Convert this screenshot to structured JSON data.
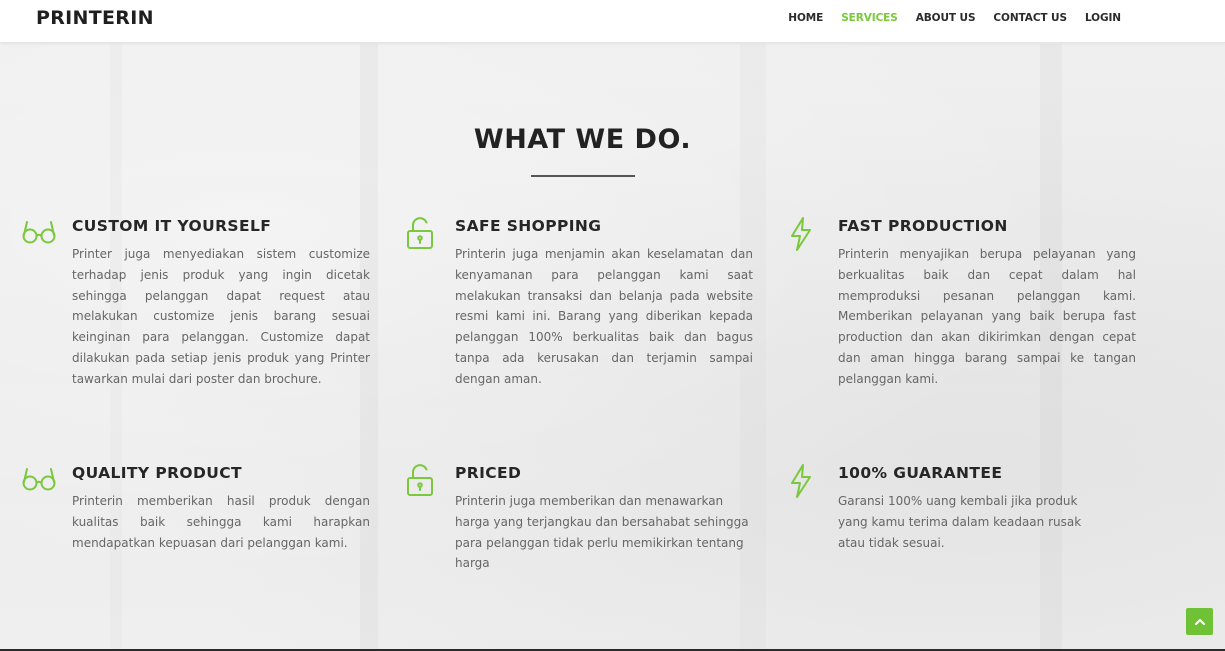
{
  "navbar": {
    "brand": "PRINTERIN",
    "items": [
      {
        "label": "HOME",
        "active": false
      },
      {
        "label": "SERVICES",
        "active": true
      },
      {
        "label": "ABOUT US",
        "active": false
      },
      {
        "label": "CONTACT US",
        "active": false
      },
      {
        "label": "LOGIN",
        "active": false
      }
    ]
  },
  "section": {
    "title": "WHAT WE DO.",
    "features": [
      {
        "icon": "glasses-icon",
        "title": "CUSTOM IT YOURSELF",
        "text": "Printer juga menyediakan sistem customize terhadap jenis produk yang ingin dicetak sehingga pelanggan dapat request atau melakukan customize jenis barang sesuai keinginan para pelanggan. Customize dapat dilakukan pada setiap jenis produk yang Printer tawarkan mulai dari poster dan brochure."
      },
      {
        "icon": "unlock-icon",
        "title": "SAFE SHOPPING",
        "text": "Printerin juga menjamin akan keselamatan dan kenyamanan para pelanggan kami saat melakukan transaksi dan belanja pada website resmi kami ini. Barang yang diberikan kepada pelanggan 100% berkualitas baik dan bagus tanpa ada kerusakan dan terjamin sampai dengan aman."
      },
      {
        "icon": "lightning-icon",
        "title": "FAST PRODUCTION",
        "text": "Printerin menyajikan berupa pelayanan yang berkualitas baik dan cepat dalam hal memproduksi pesanan pelanggan kami. Memberikan pelayanan yang baik berupa fast production dan akan dikirimkan dengan cepat dan aman hingga barang sampai ke tangan pelanggan kami."
      },
      {
        "icon": "glasses-icon",
        "title": "QUALITY PRODUCT",
        "text": "Printerin memberikan hasil produk dengan kualitas baik sehingga kami harapkan mendapatkan kepuasan dari pelanggan kami."
      },
      {
        "icon": "unlock-icon",
        "title": "PRICED",
        "text": "Printerin juga memberikan dan menawarkan harga yang terjangkau dan bersahabat sehingga para pelanggan tidak perlu memikirkan tentang harga"
      },
      {
        "icon": "lightning-icon",
        "title": "100% GUARANTEE",
        "text": "Garansi 100% uang kembali jika produk yang kamu terima dalam keadaan rusak atau tidak sesuai."
      }
    ]
  },
  "colors": {
    "accent": "#7ac83b",
    "to_top_button": "#6fc236",
    "heading": "#222222",
    "body_text": "#666666"
  },
  "scroll_to_top": {
    "icon": "chevron-up-icon"
  }
}
